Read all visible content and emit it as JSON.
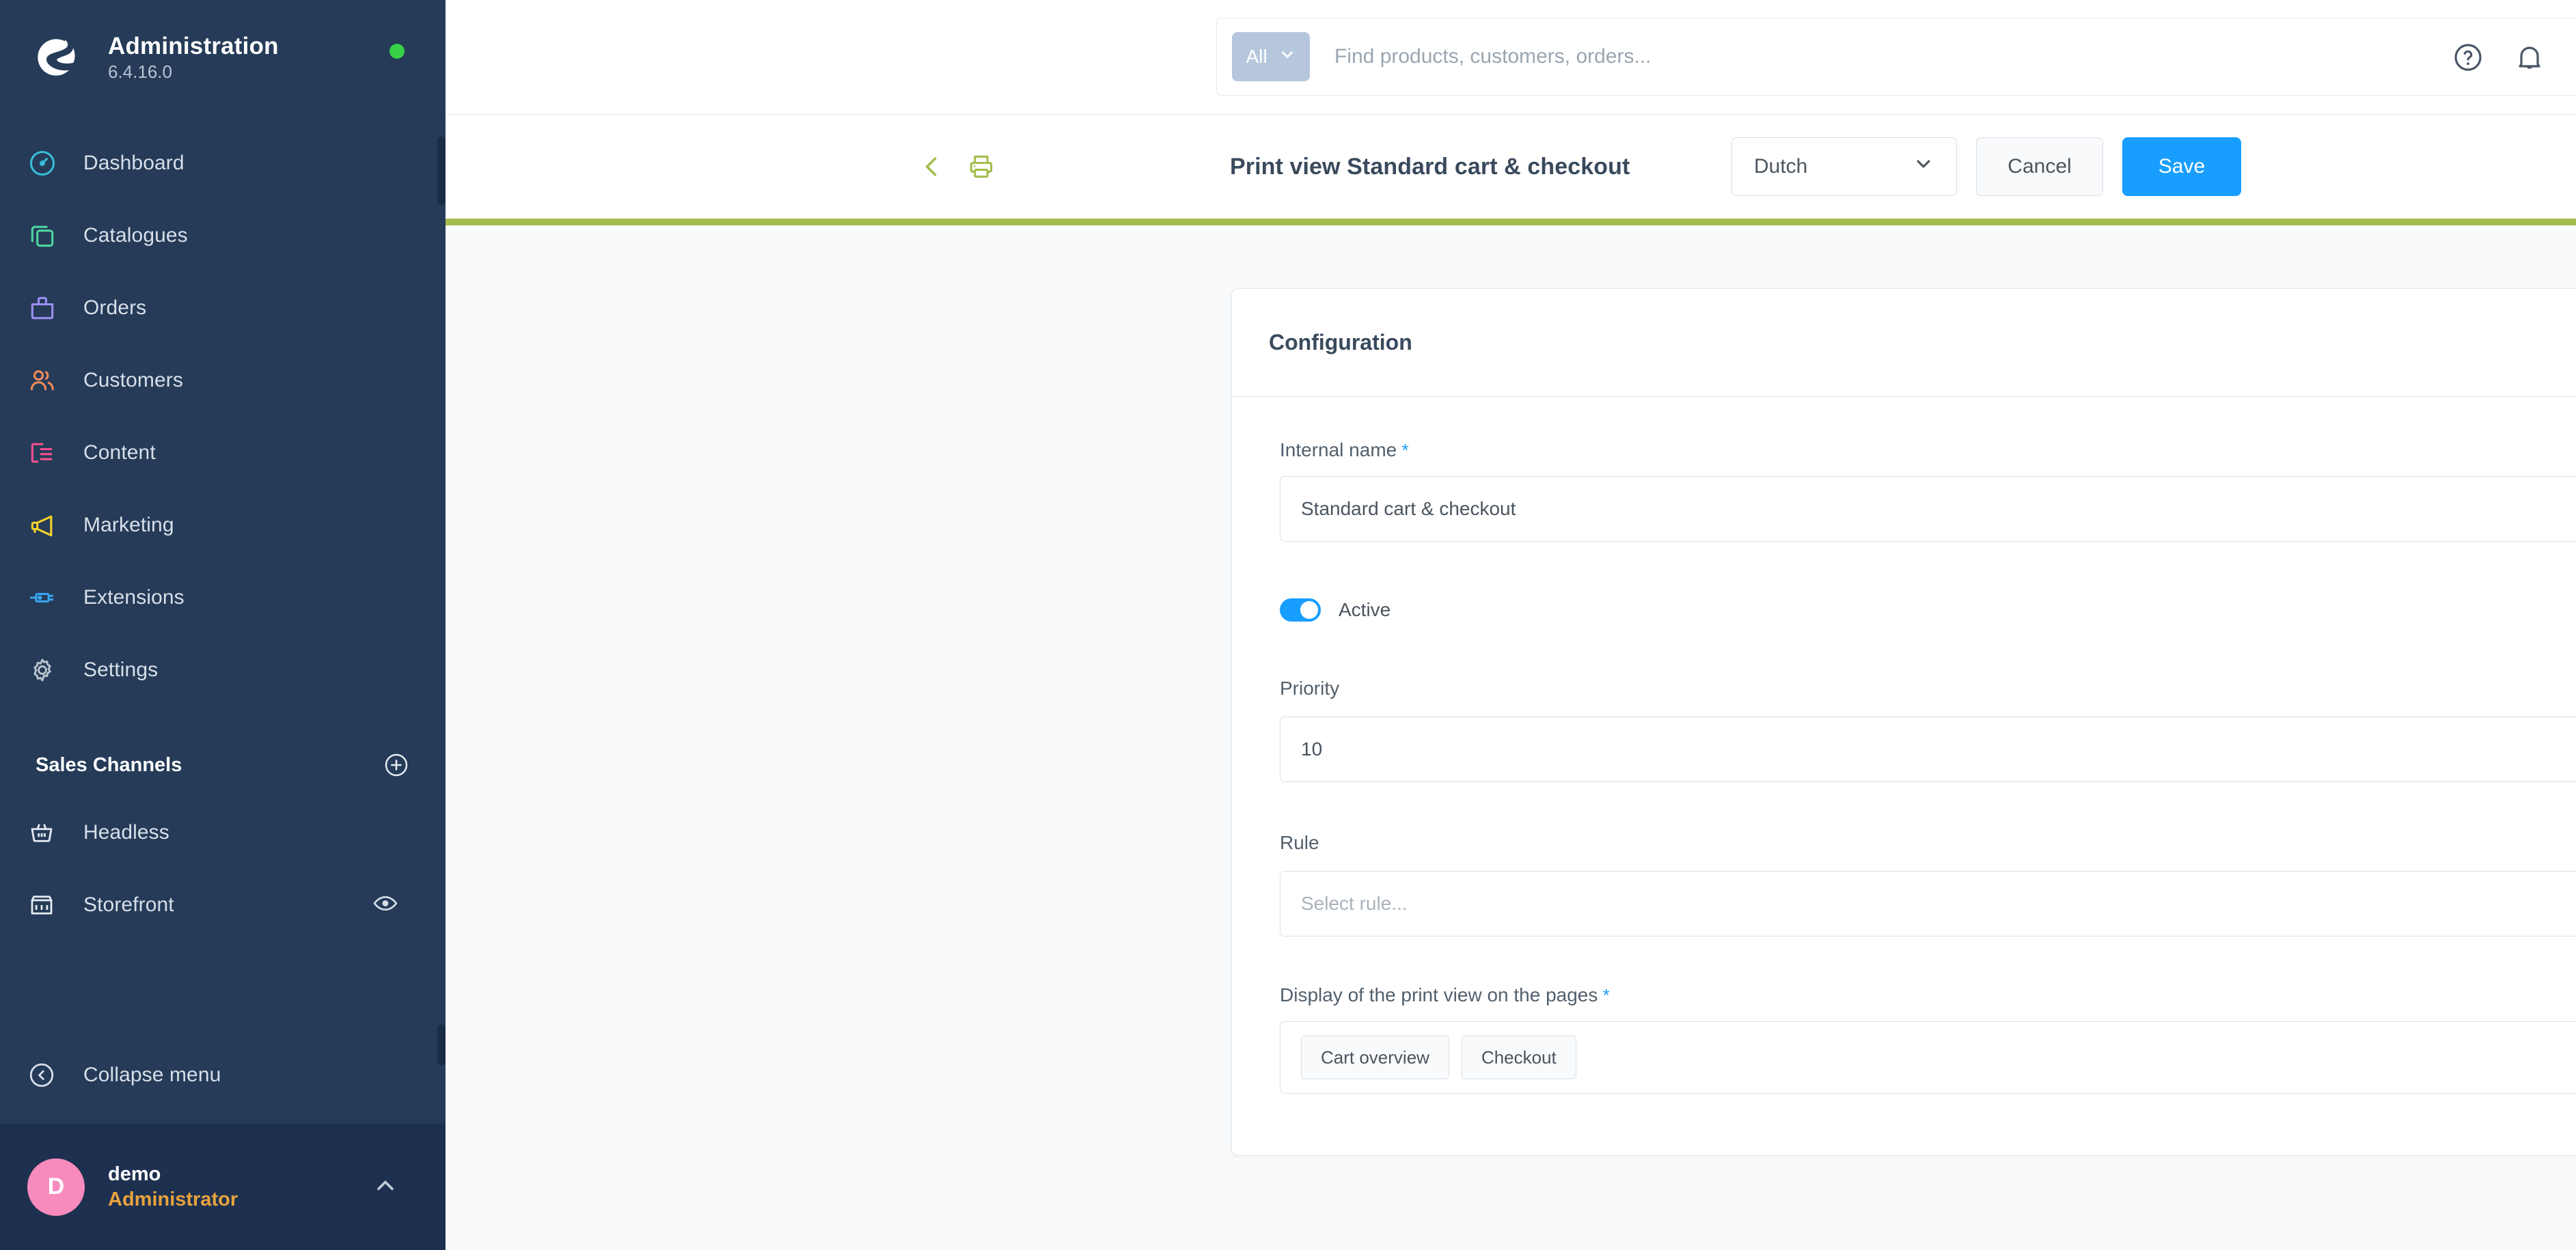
{
  "sidebar": {
    "brand": {
      "title": "Administration",
      "version": "6.4.16.0",
      "status_dot_color": "#37d047"
    },
    "nav": [
      {
        "label": "Dashboard",
        "icon": "dashboard-icon",
        "color": "#38bdd8"
      },
      {
        "label": "Catalogues",
        "icon": "catalogues-icon",
        "color": "#4fd5a0"
      },
      {
        "label": "Orders",
        "icon": "orders-icon",
        "color": "#9b8ef0"
      },
      {
        "label": "Customers",
        "icon": "customers-icon",
        "color": "#f08a5a"
      },
      {
        "label": "Content",
        "icon": "content-icon",
        "color": "#f5508f"
      },
      {
        "label": "Marketing",
        "icon": "marketing-icon",
        "color": "#f2d12b"
      },
      {
        "label": "Extensions",
        "icon": "extensions-icon",
        "color": "#38a7f0"
      },
      {
        "label": "Settings",
        "icon": "settings-icon",
        "color": "#b9c2cd"
      }
    ],
    "sales_channels": {
      "title": "Sales Channels",
      "add_icon": "plus-circle-icon",
      "items": [
        {
          "label": "Headless",
          "icon": "basket-icon",
          "has_preview": false
        },
        {
          "label": "Storefront",
          "icon": "storefront-icon",
          "has_preview": true,
          "preview_icon": "eye-icon"
        }
      ]
    },
    "collapse": {
      "label": "Collapse menu",
      "icon": "collapse-left-icon"
    },
    "user": {
      "initial": "D",
      "name": "demo",
      "role": "Administrator",
      "avatar_color": "#f88bbd",
      "chevron": "chevron-up-icon"
    }
  },
  "topbar": {
    "search": {
      "scope_label": "All",
      "scope_chevron": "chevron-down-icon",
      "placeholder": "Find products, customers, orders...",
      "value": "",
      "search_icon": "search-icon"
    },
    "actions": [
      {
        "name": "help-icon",
        "label": "Help"
      },
      {
        "name": "bell-icon",
        "label": "Notifications"
      }
    ]
  },
  "pagehead": {
    "back_icon": "chevron-left-icon",
    "print_icon": "printer-icon",
    "title": "Print view Standard cart & checkout",
    "language": {
      "value": "Dutch",
      "chevron": "chevron-down-icon"
    },
    "cancel_label": "Cancel",
    "save_label": "Save",
    "accent_color": "#a3be4c"
  },
  "card": {
    "title": "Configuration",
    "internal_name": {
      "label": "Internal name",
      "required": true,
      "value": "Standard cart & checkout"
    },
    "active": {
      "label": "Active",
      "enabled": true,
      "help_icon": "question-icon"
    },
    "priority": {
      "label": "Priority",
      "value": "10",
      "help_icon": "question-icon"
    },
    "rule": {
      "label": "Rule",
      "placeholder": "Select rule...",
      "value": "",
      "help_icon": "question-icon",
      "chevron": "chevron-down-icon"
    },
    "display_pages": {
      "label": "Display of the print view on the pages",
      "required": true,
      "tags": [
        "Cart overview",
        "Checkout"
      ],
      "chevron": "chevron-down-icon"
    }
  }
}
